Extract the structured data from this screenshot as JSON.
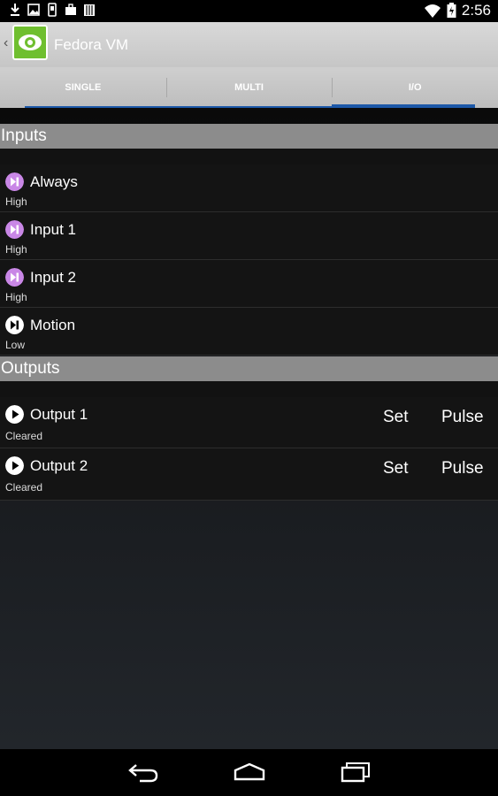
{
  "status_bar": {
    "time": "2:56",
    "left_icons": [
      "download-icon",
      "image-icon",
      "phone-icon",
      "briefcase-icon",
      "barcode-icon"
    ],
    "right_icons": [
      "wifi-icon",
      "battery-charging-icon"
    ]
  },
  "app_bar": {
    "title": "Fedora VM",
    "icon": "eye-logo-icon",
    "accent_color": "#6fbf2f"
  },
  "tabs": [
    {
      "label": "SINGLE",
      "active": false
    },
    {
      "label": "MULTI",
      "active": false
    },
    {
      "label": "I/O",
      "active": true
    }
  ],
  "accent_color": "#1c58a8",
  "inputs": {
    "header": "Inputs",
    "items": [
      {
        "name": "Always",
        "state": "High",
        "icon_color": "#c987e6"
      },
      {
        "name": "Input 1",
        "state": "High",
        "icon_color": "#c987e6"
      },
      {
        "name": "Input 2",
        "state": "High",
        "icon_color": "#c987e6"
      },
      {
        "name": "Motion",
        "state": "Low",
        "icon_color": "#ffffff"
      }
    ]
  },
  "outputs": {
    "header": "Outputs",
    "set_label": "Set",
    "pulse_label": "Pulse",
    "items": [
      {
        "name": "Output 1",
        "state": "Cleared"
      },
      {
        "name": "Output 2",
        "state": "Cleared"
      }
    ]
  },
  "nav_bar": {
    "buttons": [
      "back-icon",
      "home-icon",
      "recents-icon"
    ]
  }
}
